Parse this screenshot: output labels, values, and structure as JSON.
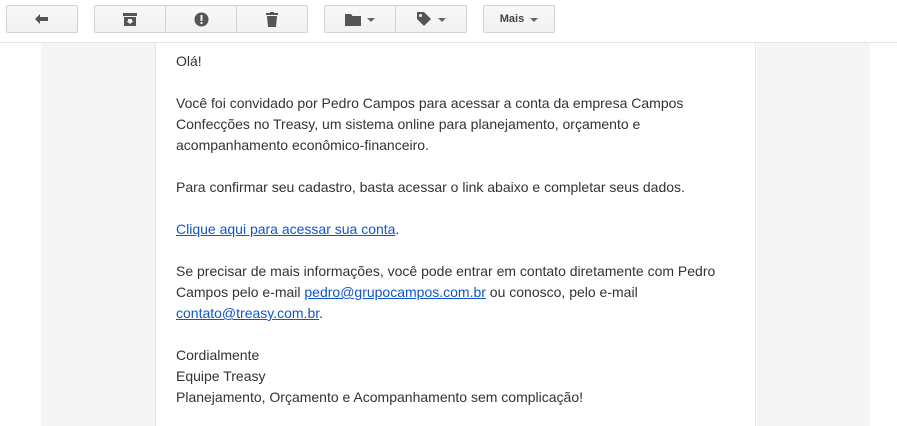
{
  "toolbar": {
    "back_icon": "back-arrow-icon",
    "archive_icon": "archive-icon",
    "spam_icon": "report-spam-icon",
    "delete_icon": "trash-icon",
    "move_icon": "folder-icon",
    "labels_icon": "tag-icon",
    "more_label": "Mais"
  },
  "email": {
    "greeting": "Olá!",
    "invite_text": "Você foi convidado por Pedro Campos para acessar a conta da empresa Campos Confecções no Treasy, um sistema online para planejamento, orçamento e acompanhamento econômico-financeiro.",
    "confirm_text": "Para confirmar seu cadastro, basta acessar o link abaixo e completar seus dados.",
    "access_link": "Clique aqui para acessar sua conta",
    "access_link_suffix": ".",
    "contact_text_1": "Se precisar de mais informações, você pode entrar em contato diretamente com Pedro Campos pelo e-mail ",
    "contact_email_1": "pedro@grupocampos.com.br",
    "contact_text_2": " ou conosco, pelo e-mail ",
    "contact_email_2": "contato@treasy.com.br",
    "contact_text_3": ".",
    "signoff": "Cordialmente",
    "team": "Equipe Treasy",
    "tagline": "Planejamento, Orçamento e Acompanhamento sem complicação!"
  },
  "colors": {
    "link": "#1155cc",
    "text": "#333333",
    "gutter": "#f5f5f5"
  }
}
